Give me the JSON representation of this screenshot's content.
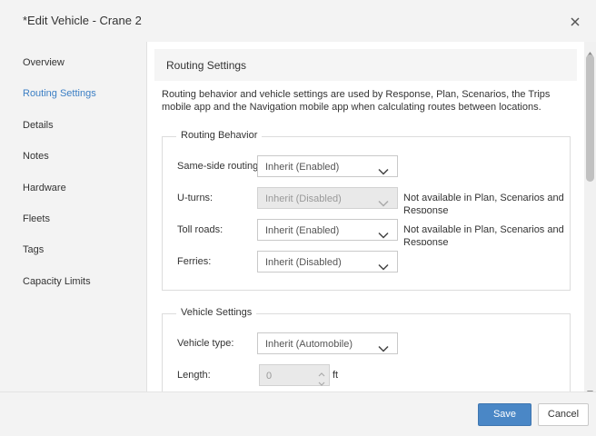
{
  "dialog": {
    "title": "*Edit Vehicle - Crane 2"
  },
  "sidebar": {
    "items": [
      {
        "label": "Overview"
      },
      {
        "label": "Routing Settings",
        "active": true
      },
      {
        "label": "Details"
      },
      {
        "label": "Notes"
      },
      {
        "label": "Hardware"
      },
      {
        "label": "Fleets"
      },
      {
        "label": "Tags"
      },
      {
        "label": "Capacity Limits"
      }
    ]
  },
  "main": {
    "section_title": "Routing Settings",
    "intro": "Routing behavior and vehicle settings are used by Response, Plan, Scenarios, the Trips mobile app and the Navigation mobile app when calculating routes between locations.",
    "routing_behavior": {
      "legend": "Routing Behavior",
      "same_side": {
        "label": "Same-side routing:",
        "value": "Inherit (Enabled)"
      },
      "u_turns": {
        "label": "U-turns:",
        "value": "Inherit (Disabled)",
        "note": "Not available in Plan, Scenarios and Response"
      },
      "toll_roads": {
        "label": "Toll roads:",
        "value": "Inherit (Enabled)",
        "note": "Not available in Plan, Scenarios and Response"
      },
      "ferries": {
        "label": "Ferries:",
        "value": "Inherit (Disabled)"
      }
    },
    "vehicle_settings": {
      "legend": "Vehicle Settings",
      "vehicle_type": {
        "label": "Vehicle type:",
        "value": "Inherit (Automobile)"
      },
      "length": {
        "label": "Length:",
        "value": "0",
        "unit": "ft"
      }
    }
  },
  "footer": {
    "save_label": "Save",
    "cancel_label": "Cancel"
  },
  "colors": {
    "accent": "#3c7fc4",
    "primary_button": "#4a87c6",
    "panel_bg": "#f3f3f3"
  },
  "icons": {
    "close": "close-icon",
    "dropdown": "chevron-down-icon",
    "stepper_up": "chevron-up-icon",
    "stepper_down": "chevron-down-icon"
  }
}
